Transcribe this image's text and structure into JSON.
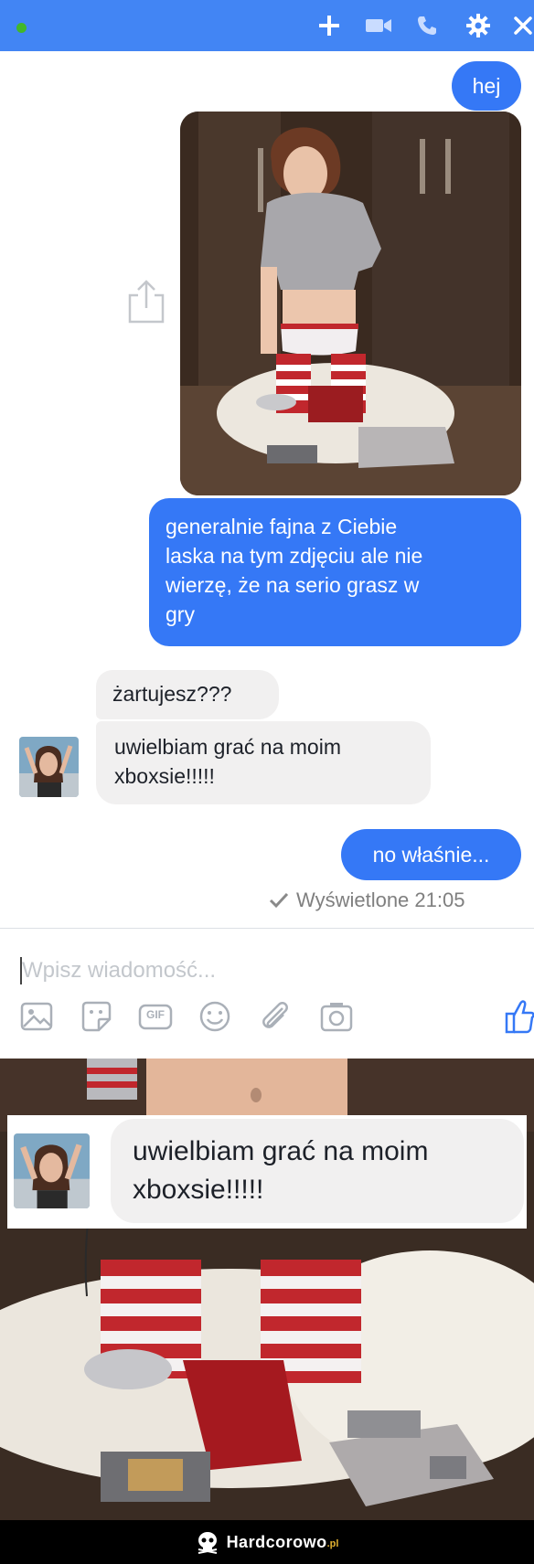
{
  "header": {
    "status": "online",
    "icons": [
      "plus-icon",
      "video-icon",
      "phone-icon",
      "gear-icon",
      "close-icon"
    ],
    "color": "#4285f4"
  },
  "messages": {
    "out1": "hej",
    "out2_lines": [
      "generalnie fajna z Ciebie",
      "laska na tym zdjęciu ale nie",
      "wierzę, że na serio grasz w",
      "gry"
    ],
    "in1": "żartujesz???",
    "in2_lines": [
      "uwielbiam grać na moim",
      "xboxsie!!!!!"
    ],
    "out3": "no właśnie..."
  },
  "seen": {
    "label": "Wyświetlone 21:05"
  },
  "composer": {
    "placeholder": "Wpisz wiadomość..."
  },
  "toolbar": {
    "icons": [
      "image-icon",
      "sticker-icon",
      "gif-icon",
      "emoji-icon",
      "attachment-icon",
      "camera-icon",
      "like-icon"
    ],
    "gif_label": "GIF"
  },
  "zoom": {
    "lines": [
      "uwielbiam grać na moim",
      "xboxsie!!!!!"
    ]
  },
  "footer": {
    "brand": "Hardcorowo",
    "tld": ".pl"
  },
  "colors": {
    "outgoing": "#3578f6",
    "incoming": "#f1f0f0",
    "online": "#42b72a"
  }
}
